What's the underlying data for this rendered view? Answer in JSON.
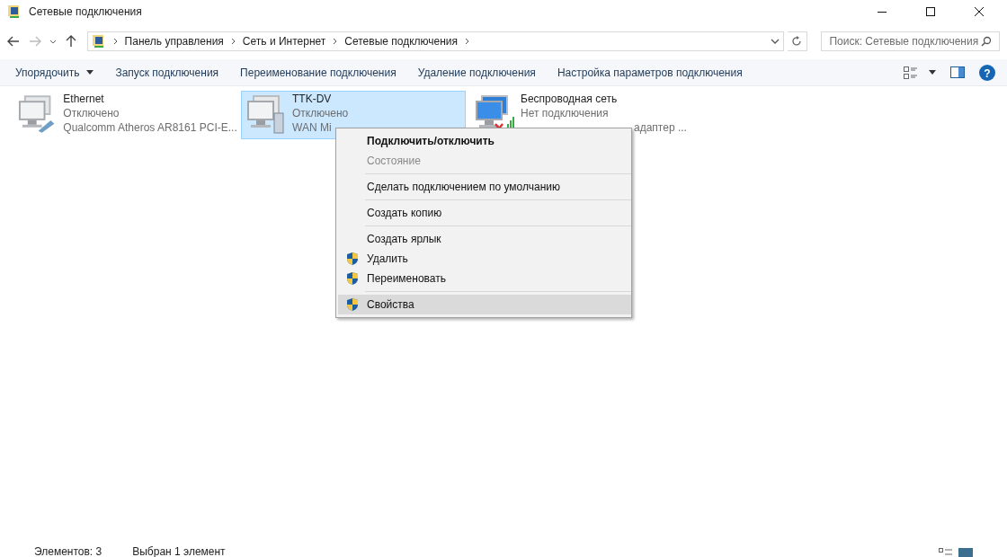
{
  "window": {
    "title": "Сетевые подключения"
  },
  "breadcrumb": [
    "Панель управления",
    "Сеть и Интернет",
    "Сетевые подключения"
  ],
  "search": {
    "placeholder": "Поиск: Сетевые подключения"
  },
  "toolbar": [
    {
      "label": "Упорядочить",
      "dropdown": true
    },
    {
      "label": "Запуск подключения",
      "dropdown": false
    },
    {
      "label": "Переименование подключения",
      "dropdown": false
    },
    {
      "label": "Удаление подключения",
      "dropdown": false
    },
    {
      "label": "Настройка параметров подключения",
      "dropdown": false
    }
  ],
  "connections": [
    {
      "name": "Ethernet",
      "status": "Отключено",
      "device": "Qualcomm Atheros AR8161 PCI-E...",
      "kind": "ethernet",
      "selected": false
    },
    {
      "name": "TTK-DV",
      "status": "Отключено",
      "device": "WAN Mi",
      "kind": "wan",
      "selected": true
    },
    {
      "name": "Беспроводная сеть",
      "status": "Нет подключения",
      "device": "адаптер ...",
      "kind": "wireless",
      "selected": false
    }
  ],
  "context_menu": [
    [
      {
        "label": "Подключить/отключить",
        "bold": true,
        "disabled": false,
        "shield": false,
        "selected": false
      },
      {
        "label": "Состояние",
        "bold": false,
        "disabled": true,
        "shield": false,
        "selected": false
      }
    ],
    [
      {
        "label": "Сделать подключением по умолчанию",
        "bold": false,
        "disabled": false,
        "shield": false,
        "selected": false
      }
    ],
    [
      {
        "label": "Создать копию",
        "bold": false,
        "disabled": false,
        "shield": false,
        "selected": false
      }
    ],
    [
      {
        "label": "Создать ярлык",
        "bold": false,
        "disabled": false,
        "shield": false,
        "selected": false
      },
      {
        "label": "Удалить",
        "bold": false,
        "disabled": false,
        "shield": true,
        "selected": false
      },
      {
        "label": "Переименовать",
        "bold": false,
        "disabled": false,
        "shield": true,
        "selected": false
      }
    ],
    [
      {
        "label": "Свойства",
        "bold": false,
        "disabled": false,
        "shield": true,
        "selected": true
      }
    ]
  ],
  "help_button": "?",
  "status_bar": [
    "Элементов: 3",
    "Выбран 1 элемент"
  ]
}
